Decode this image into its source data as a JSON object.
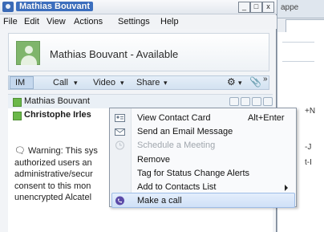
{
  "window": {
    "title": "Mathias Bouvant",
    "minimize": "_",
    "maximize": "□",
    "close": "x"
  },
  "menu": [
    "File",
    "Edit",
    "View",
    "Actions",
    "Settings",
    "Help"
  ],
  "header": {
    "display_name": "Mathias Bouvant - Available"
  },
  "actions": {
    "im": "IM",
    "call": "Call",
    "video": "Video",
    "share": "Share",
    "more": "»"
  },
  "contacts": [
    {
      "name": "Mathias Bouvant"
    },
    {
      "name": "Christophe Irles"
    }
  ],
  "warning_lines": [
    "Warning: This sys",
    "authorized users an",
    "administrative/secur",
    "consent to this mon",
    "unencrypted Alcatel"
  ],
  "context_menu": {
    "items": [
      {
        "label": "View Contact Card",
        "shortcut": "Alt+Enter",
        "icon": "contact-card-icon"
      },
      {
        "label": "Send an Email Message",
        "icon": "email-icon"
      },
      {
        "label": "Schedule a Meeting",
        "icon": "meeting-icon",
        "disabled": true
      },
      {
        "label": "Remove"
      },
      {
        "label": "Tag for Status Change Alerts"
      },
      {
        "label": "Add to Contacts List",
        "submenu": true
      },
      {
        "label": "Make a call",
        "icon": "phone-icon",
        "highlighted": true
      }
    ]
  },
  "background_window": {
    "title_fragment": "appe",
    "fragments": [
      "+N",
      "-J",
      "t-I"
    ]
  },
  "colors": {
    "title_accent": "#3c6fbf",
    "status_available": "#6bb84a",
    "highlight": "#cfe0f7"
  }
}
